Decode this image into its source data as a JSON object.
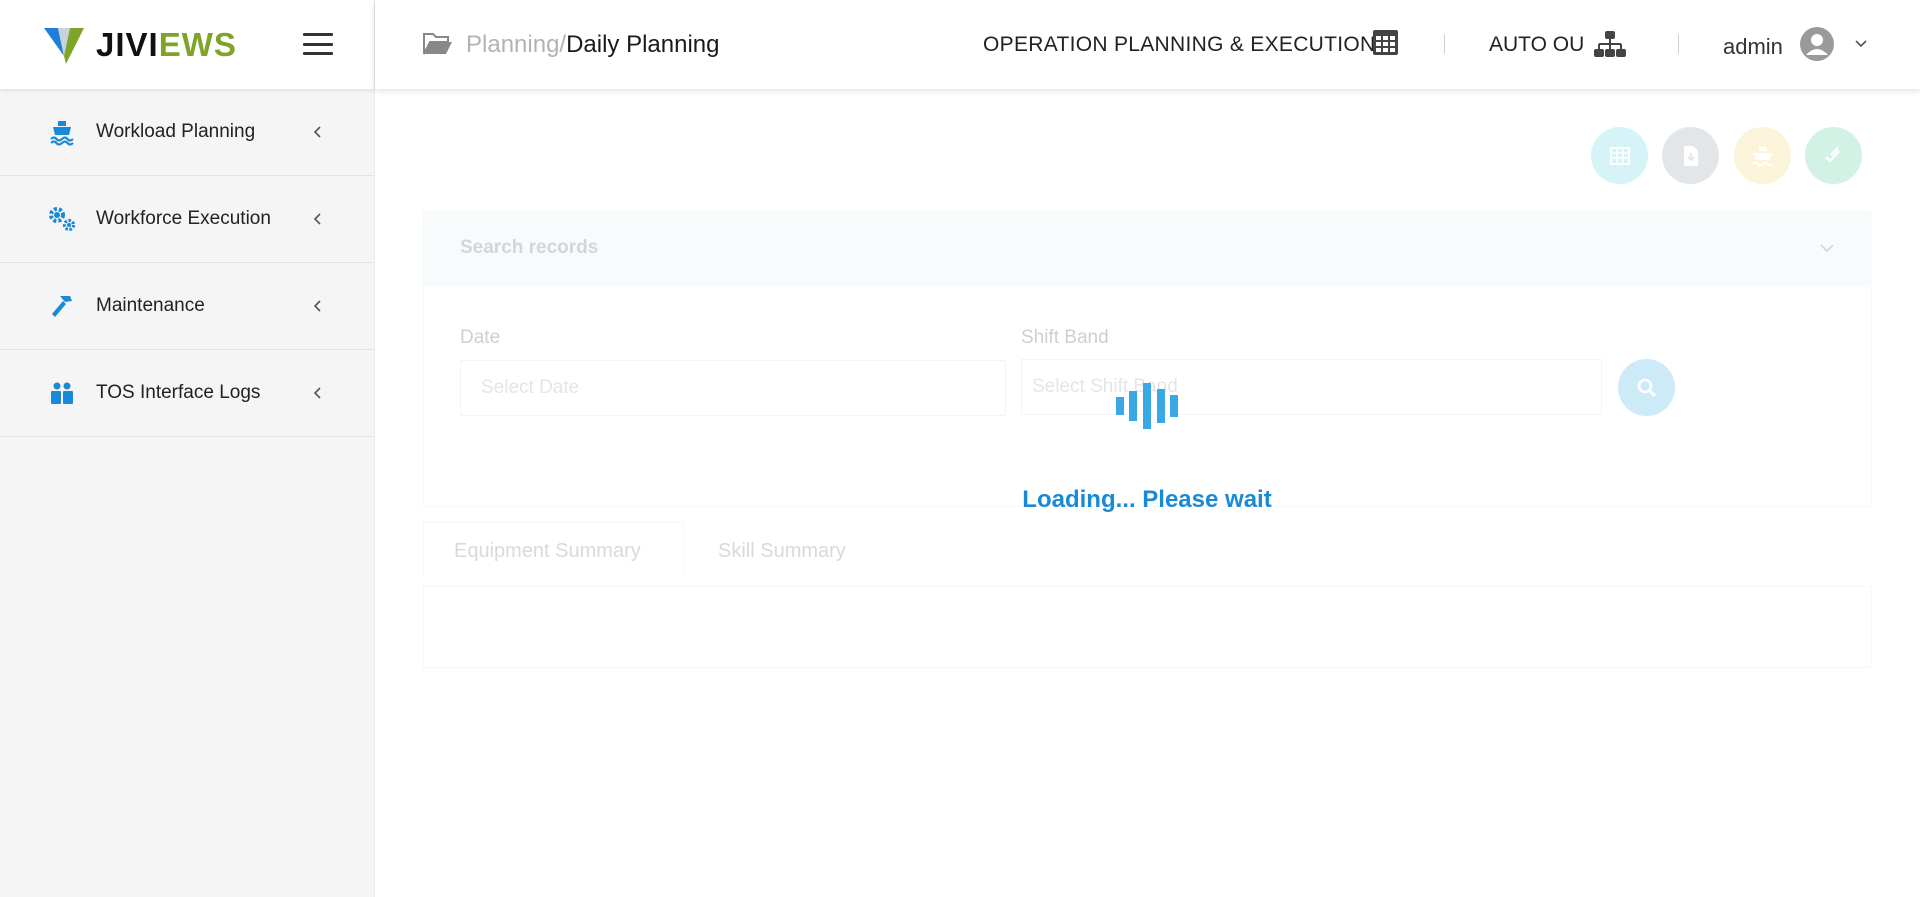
{
  "brand": {
    "name_part1": "JIVI",
    "name_part2": "EWS"
  },
  "sidebar": {
    "items": [
      {
        "label": "Workload Planning",
        "icon": "ship-icon"
      },
      {
        "label": "Workforce Execution",
        "icon": "gears-icon"
      },
      {
        "label": "Maintenance",
        "icon": "hammer-icon"
      },
      {
        "label": "TOS Interface Logs",
        "icon": "users-box-icon"
      }
    ]
  },
  "header": {
    "breadcrumb_parent": "Planning/",
    "breadcrumb_current": "Daily Planning",
    "module": "OPERATION PLANNING & EXECUTION",
    "ou": "AUTO OU",
    "user": "admin"
  },
  "search": {
    "title": "Search records",
    "date_label": "Date",
    "date_placeholder": "Select Date",
    "shift_label": "Shift Band",
    "shift_placeholder": "Select Shift Band"
  },
  "tabs": [
    "Equipment Summary",
    "Skill Summary"
  ],
  "loader": {
    "text": "Loading... Please wait"
  },
  "colors": {
    "accent": "#1a8ad6",
    "brand_green": "#7ea52a",
    "action_teal": "#6cd3e0",
    "action_gray": "#9aa5b1",
    "action_yellow": "#f5d77a",
    "action_green": "#5fd0a0"
  }
}
